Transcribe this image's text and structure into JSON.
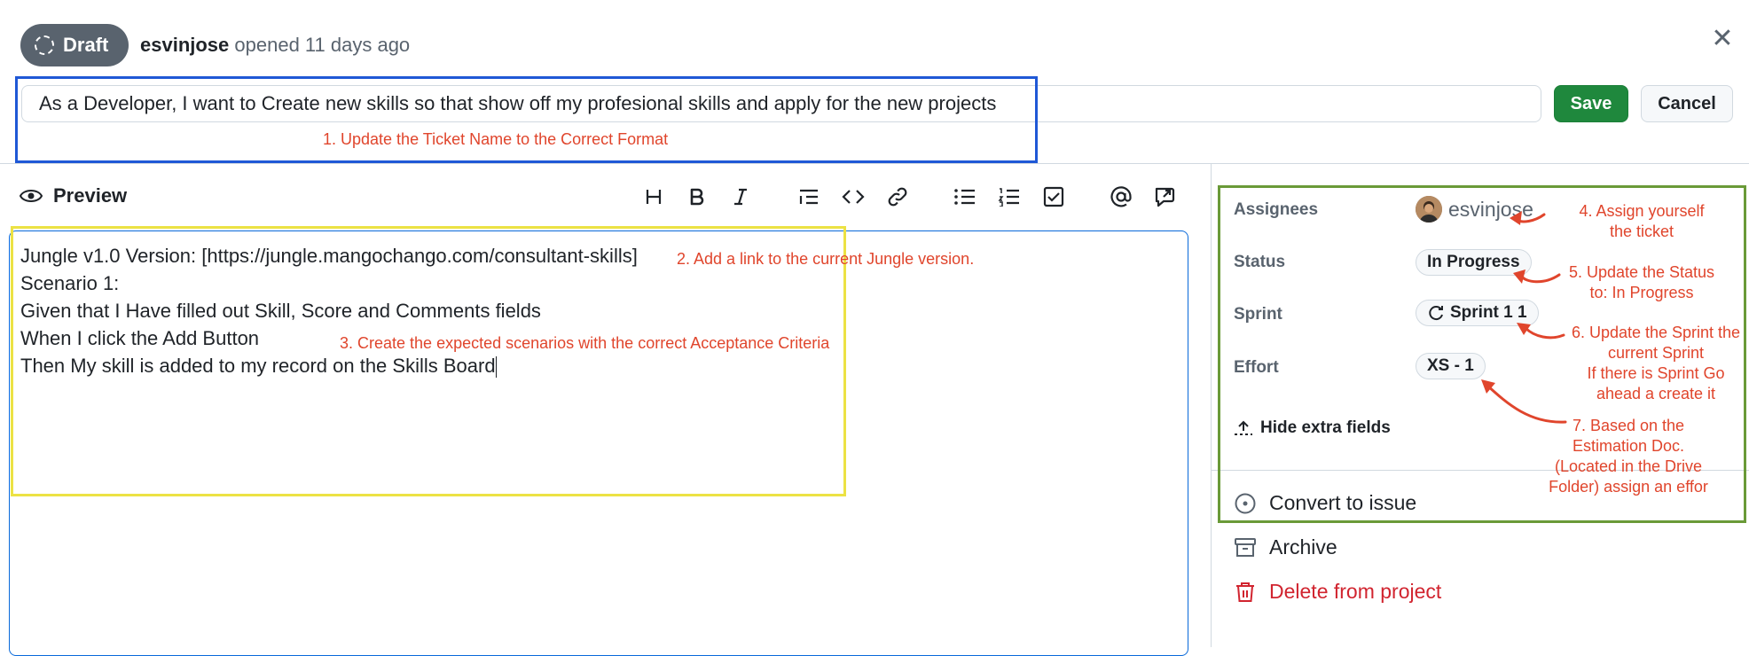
{
  "header": {
    "status_badge": "Draft",
    "author": "esvinjose",
    "opened_text": "opened 11 days ago"
  },
  "title_field": {
    "value": "As a Developer, I want to Create new skills so that show off my profesional skills and apply for the new projects"
  },
  "buttons": {
    "save": "Save",
    "cancel": "Cancel"
  },
  "editor_toolbar": {
    "preview_label": "Preview",
    "tools": [
      "heading-icon",
      "bold-icon",
      "italic-icon",
      "quote-icon",
      "code-icon",
      "link-icon",
      "bulleted-list-icon",
      "numbered-list-icon",
      "task-list-icon",
      "mention-icon",
      "reference-icon"
    ]
  },
  "editor": {
    "lines": [
      "Jungle v1.0 Version: [https://jungle.mangochango.com/consultant-skills]",
      "Scenario 1:",
      "Given that I Have filled out Skill, Score and Comments fields",
      "When I click the Add Button",
      "Then My skill is added to my record on the Skills Board"
    ]
  },
  "sidebar": {
    "assignees_label": "Assignees",
    "assignee": "esvinjose",
    "status_label": "Status",
    "status_value": "In Progress",
    "sprint_label": "Sprint",
    "sprint_value": "Sprint 1 1",
    "effort_label": "Effort",
    "effort_value": "XS - 1",
    "hide_fields": "Hide extra fields",
    "convert": "Convert to issue",
    "archive": "Archive",
    "delete": "Delete from project"
  },
  "annotations": {
    "a1": "1. Update the Ticket Name to the Correct Format",
    "a2": "2. Add a link to the current Jungle version.",
    "a3": "3. Create the expected scenarios with the correct Acceptance Criteria",
    "a4_line1": "4.  Assign     yourself",
    "a4_line2": "the ticket",
    "a5_line1": "5. Update the Status",
    "a5_line2": "to: In Progress",
    "a6_line1": "6. Update the Sprint the",
    "a6_line2": "current Sprint",
    "a6_line3": "If there is Sprint Go",
    "a6_line4": "ahead a create it",
    "a7_line1": "7. Based on the",
    "a7_line2": "Estimation Doc.",
    "a7_line3": "(Located in the Drive",
    "a7_line4": "Folder) assign an effor"
  },
  "colors": {
    "save_green": "#1f883d",
    "annotation_red": "#e0452c",
    "box_blue": "#1f58d6",
    "box_yellow": "#ece244",
    "box_green": "#6a9a38",
    "delete_red": "#d1242f",
    "draft_gray": "#59636e"
  }
}
